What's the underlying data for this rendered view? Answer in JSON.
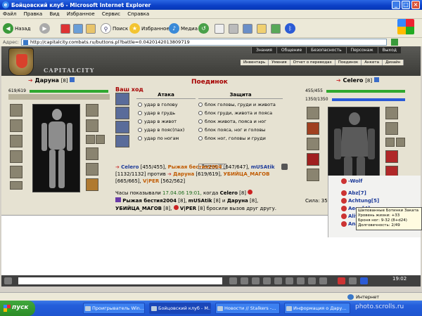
{
  "window": {
    "title": "Бойцовский клуб - Microsoft Internet Explorer"
  },
  "menu": [
    "Файл",
    "Правка",
    "Вид",
    "Избранное",
    "Сервис",
    "Справка"
  ],
  "toolbar": {
    "back": "Назад",
    "search": "Поиск",
    "favorites": "Избранное",
    "media": "Медиа"
  },
  "address": {
    "label": "Адрес:",
    "url": "http://capitalcity.combats.ru/buttons.pl?battle=0.0420142013809719"
  },
  "game": {
    "logo": "CAPITALCITY",
    "topnav": [
      "Знания",
      "Общение",
      "Безопасность",
      "Персонаж",
      "Выход"
    ],
    "subnav": [
      "Инвентарь",
      "Умения",
      "Отчет о переводах",
      "Поединок",
      "Анкета",
      "Дизайн"
    ],
    "left": {
      "name": "Даруна",
      "level": "[8]",
      "hp": "619/619",
      "hp_frac": 1.0
    },
    "right": {
      "name": "Celero",
      "level": "[8]",
      "hp": "455/455",
      "mana": "1350/1350",
      "hp_frac": 1.0,
      "mana_frac": 1.0,
      "stats": [
        {
          "label": "Сила:",
          "value": "35"
        }
      ]
    },
    "fight": {
      "title": "Поединок",
      "mycode": "Ваш ход",
      "attack_head": "Атака",
      "defense_head": "Защита",
      "attacks": [
        "удар в голову",
        "удар в грудь",
        "удар в живот",
        "удар в пояс(пах)",
        "удар по ногам"
      ],
      "defenses": [
        "блок головы, груди и живота",
        "блок груди, живота и пояса",
        "блок живота, пояса и ног",
        "блок пояса, ног и головы",
        "блок ног, головы и груди"
      ],
      "forward": "Вперед !!!"
    },
    "battle": {
      "line1_a": "Celero",
      "line1_b": "[455/455],",
      "line1_c": "Рыжая бестия2004",
      "line1_d": "[647/647],",
      "line1_e": "mUSAtik",
      "line2_a": "[1132/1132]",
      "line2_b": "против",
      "line2_c": "Даруна",
      "line2_d": "[619/619],",
      "line2_e": "УБИЙЦА_МАГОВ",
      "line3_a": "[665/665],",
      "line3_b": "V|PER",
      "line3_c": "[562/562]"
    },
    "log": {
      "l1_a": "Часы показывали",
      "l1_b": "17.04.06 19:01,",
      "l1_c": "когда",
      "l1_d": "Celero",
      "l1_e": "[8]",
      "l2_a": "Рыжая бестия2004",
      "l2_b": "[8]",
      "l2_c": "mUSAtik",
      "l2_d": "[8]",
      "l2_e": "и",
      "l2_f": "Даруна",
      "l2_g": "[8]",
      "l3_a": "УБИЙЦА_МАГОВ",
      "l3_b": "[8]",
      "l3_c": "V|PER",
      "l3_d": "[8]",
      "l3_e": "бросили вызов друг другу."
    },
    "chat": [
      "-Wolf",
      "Abz[7]",
      "Achtung[5]",
      "Aega[4]",
      "Aliveruler[7]",
      "Anakondamis[1]"
    ],
    "tooltip": {
      "l1": "Шипованные Ботинки Заката",
      "l2": "Уровень жизни: +33",
      "l3": "Броня ног: 9-32 (8+d24)",
      "l4": "Долговечность: 2/49"
    },
    "clock": "19:02"
  },
  "status": {
    "zone": "Интернет"
  },
  "taskbar": {
    "start": "пуск",
    "tasks": [
      "Проигрыватель Win...",
      "Бойцовский клуб - М...",
      "Новости // Stalkers -...",
      "Информация о Дару..."
    ]
  },
  "watermark": "photo.scrolls.ru"
}
